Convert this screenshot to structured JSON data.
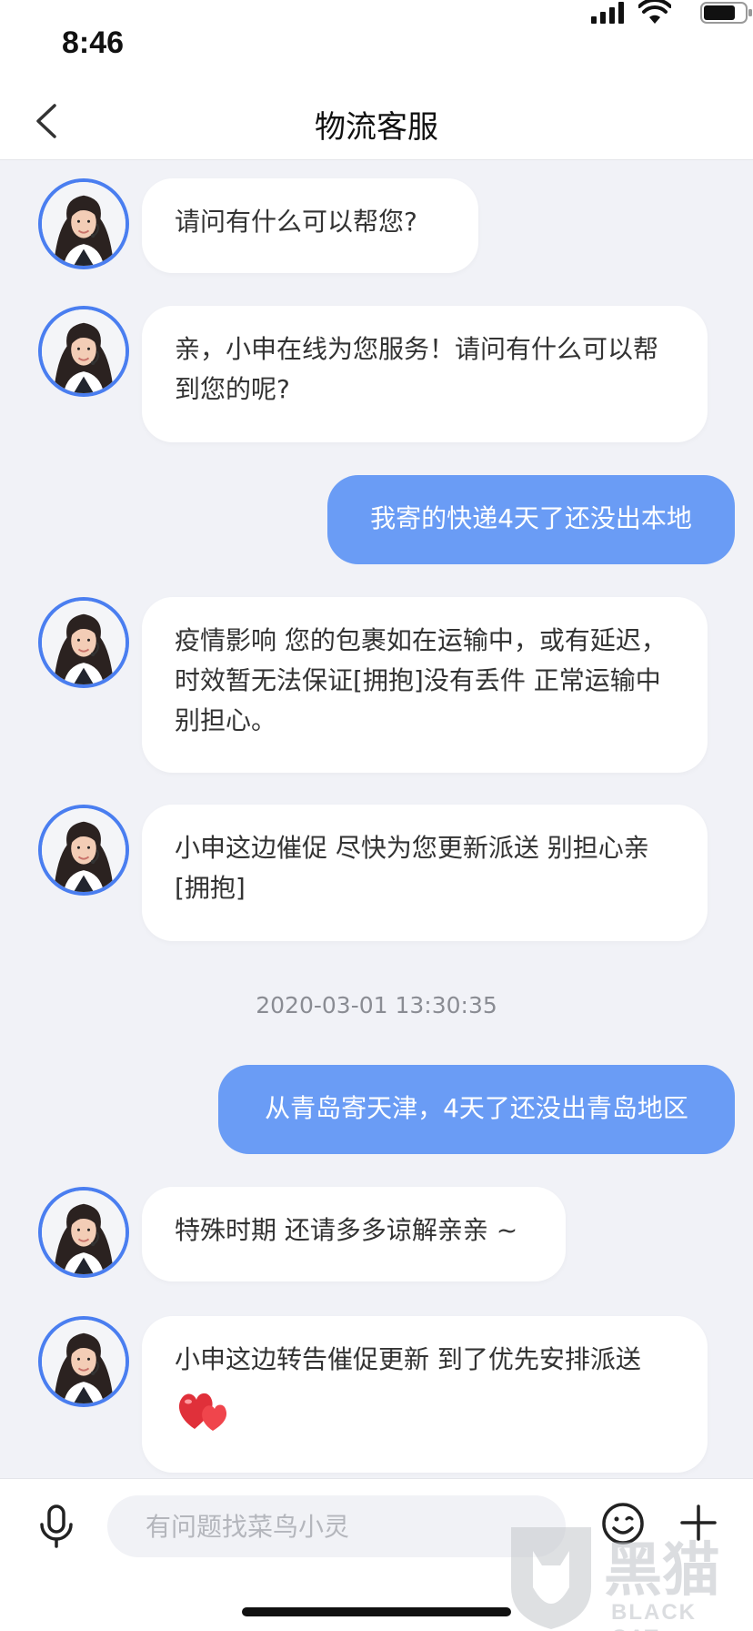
{
  "status_bar": {
    "time": "8:46"
  },
  "nav": {
    "title": "物流客服"
  },
  "messages": [
    {
      "side": "left",
      "text": "请问有什么可以帮您?"
    },
    {
      "side": "left",
      "text": "亲，小申在线为您服务！请问有什么可以帮到您的呢?"
    },
    {
      "side": "right",
      "text": "我寄的快递4天了还没出本地"
    },
    {
      "side": "left",
      "text": "疫情影响 您的包裹如在运输中，或有延迟，时效暂无法保证[拥抱]没有丢件 正常运输中 别担心。"
    },
    {
      "side": "left",
      "text": "小申这边催促 尽快为您更新派送 别担心亲[拥抱]"
    },
    {
      "side": "right",
      "text": "从青岛寄天津，4天了还没出青岛地区"
    },
    {
      "side": "left",
      "text": "特殊时期 还请多多谅解亲亲 ~"
    },
    {
      "side": "left",
      "text": "小申这边转告催促更新 到了优先安排派送"
    }
  ],
  "timestamp": "2020-03-01 13:30:35",
  "input": {
    "placeholder": "有问题找菜鸟小灵"
  },
  "watermark": {
    "name": "黑猫",
    "sub": "BLACK CAT"
  },
  "colors": {
    "accent": "#4a7ef0",
    "user_bubble": "#6a9cf5",
    "background": "#f1f2f7"
  },
  "icons": [
    "back-chevron-icon",
    "microphone-icon",
    "emoji-icon",
    "plus-icon",
    "heart-emoji-icon",
    "agent-avatar"
  ]
}
